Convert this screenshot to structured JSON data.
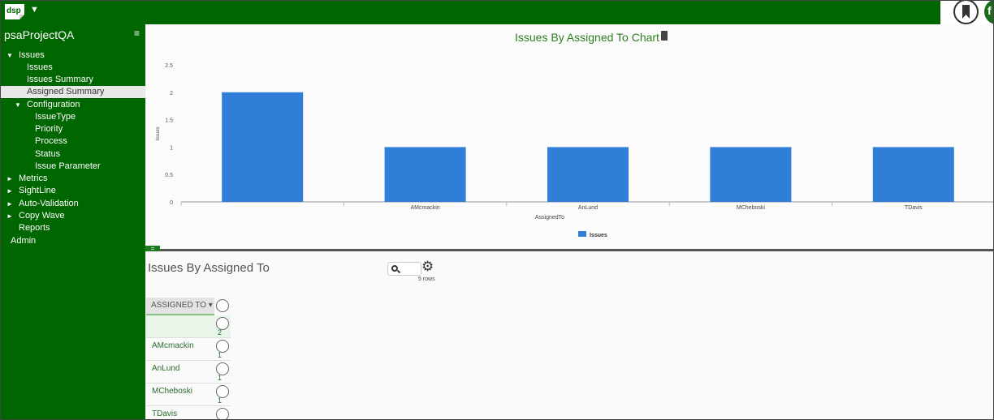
{
  "header": {
    "logo_text": "dsp",
    "menu_arrow": "▼",
    "user_initial": "f"
  },
  "sidebar": {
    "project_title": "psaProjectQA",
    "hamburger": "≡",
    "items": [
      {
        "label": "Issues",
        "arrow": "▼"
      },
      {
        "label": "Issues"
      },
      {
        "label": "Issues Summary"
      },
      {
        "label": "Assigned Summary",
        "active": true
      },
      {
        "label": "Configuration",
        "arrow": "▼"
      },
      {
        "label": "IssueType"
      },
      {
        "label": "Priority"
      },
      {
        "label": "Process"
      },
      {
        "label": "Status"
      },
      {
        "label": "Issue Parameter"
      },
      {
        "label": "Metrics",
        "arrow": "►"
      },
      {
        "label": "SightLine",
        "arrow": "►"
      },
      {
        "label": "Auto-Validation",
        "arrow": "►"
      },
      {
        "label": "Copy Wave",
        "arrow": "►"
      },
      {
        "label": "Reports"
      },
      {
        "label": "Admin"
      }
    ]
  },
  "chart": {
    "title": "Issues By Assigned To Chart"
  },
  "chart_data": {
    "type": "bar",
    "title": "Issues By Assigned To Chart",
    "categories": [
      "",
      "AMcmackin",
      "AnLund",
      "MCheboski",
      "TDavis"
    ],
    "series": [
      {
        "name": "Issues",
        "values": [
          2,
          1,
          1,
          1,
          1
        ],
        "color": "#2f7ed8"
      }
    ],
    "xlabel": "AssignedTo",
    "ylabel": "Issues",
    "ylim": [
      0,
      2.5
    ],
    "yticks": [
      "0",
      "0.5",
      "1",
      "1.5",
      "2",
      "2.5"
    ],
    "grid": false,
    "legend": "bottom-center"
  },
  "splitter": {
    "handle": "="
  },
  "grid": {
    "title": "Issues By Assigned To",
    "row_count": "5 rows",
    "gear": "⚙",
    "column_header": "ASSIGNED TO ▾",
    "rows": [
      {
        "name": "",
        "count": "2"
      },
      {
        "name": "AMcmackin",
        "count": "1"
      },
      {
        "name": "AnLund",
        "count": "1"
      },
      {
        "name": "MCheboski",
        "count": "1"
      },
      {
        "name": "TDavis",
        "count": ""
      }
    ]
  },
  "colors": {
    "brand_green": "#006600",
    "bar_blue": "#2f7ed8",
    "title_green": "#2f7d1f"
  }
}
